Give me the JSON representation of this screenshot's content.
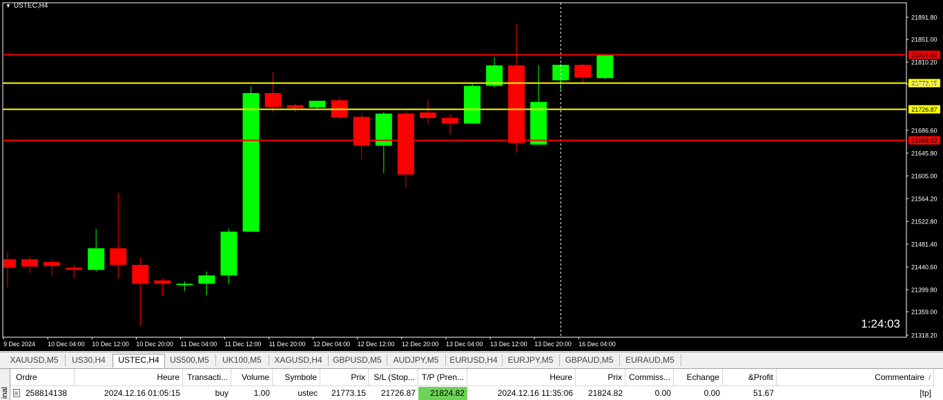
{
  "chart": {
    "title": "USTEC,H4",
    "countdown": "1:24:03",
    "price_labels": [
      "21891.80",
      "21851.00",
      "21810.20",
      "21769.40",
      "21686.60",
      "21645.80",
      "21605.00",
      "21564.20",
      "21522.80",
      "21481.40",
      "21440.60",
      "21399.80",
      "21359.00",
      "21318.20"
    ],
    "time_labels": [
      "9 Dec 2024",
      "10 Dec 04:00",
      "10 Dec 12:00",
      "10 Dec 20:00",
      "11 Dec 04:00",
      "11 Dec 12:00",
      "11 Dec 20:00",
      "12 Dec 04:00",
      "12 Dec 12:00",
      "12 Dec 20:00",
      "13 Dec 04:00",
      "13 Dec 12:00",
      "13 Dec 20:00",
      "16 Dec 04:00"
    ],
    "lines": [
      {
        "price": 21824.82,
        "label": "21824.82",
        "color": "#ff0000",
        "tag_color": "#ff0000",
        "text_color": "#000000"
      },
      {
        "price": 21773.15,
        "label": "21773.15",
        "color": "#ffff00",
        "tag_color": "#ffff00",
        "text_color": "#000000"
      },
      {
        "price": 21726.87,
        "label": "21726.87",
        "color": "#ffff00",
        "tag_color": "#ffff00",
        "text_color": "#000000"
      },
      {
        "price": 21669.82,
        "label": "21669.82",
        "color": "#ff0000",
        "tag_color": "#ff0000",
        "text_color": "#000000"
      }
    ],
    "candles": [
      {
        "o": 21455,
        "h": 21468,
        "l": 21405,
        "c": 21440
      },
      {
        "o": 21455,
        "h": 21460,
        "l": 21430,
        "c": 21442
      },
      {
        "o": 21450,
        "h": 21455,
        "l": 21425,
        "c": 21443
      },
      {
        "o": 21440,
        "h": 21445,
        "l": 21420,
        "c": 21436
      },
      {
        "o": 21436,
        "h": 21510,
        "l": 21433,
        "c": 21475
      },
      {
        "o": 21475,
        "h": 21575,
        "l": 21420,
        "c": 21445
      },
      {
        "o": 21445,
        "h": 21458,
        "l": 21335,
        "c": 21411
      },
      {
        "o": 21417,
        "h": 21420,
        "l": 21390,
        "c": 21411
      },
      {
        "o": 21409,
        "h": 21415,
        "l": 21398,
        "c": 21411
      },
      {
        "o": 21411,
        "h": 21433,
        "l": 21390,
        "c": 21426
      },
      {
        "o": 21426,
        "h": 21510,
        "l": 21410,
        "c": 21505
      },
      {
        "o": 21505,
        "h": 21767,
        "l": 21505,
        "c": 21755
      },
      {
        "o": 21755,
        "h": 21793,
        "l": 21720,
        "c": 21730
      },
      {
        "o": 21733,
        "h": 21736,
        "l": 21720,
        "c": 21728
      },
      {
        "o": 21729,
        "h": 21741,
        "l": 21727,
        "c": 21741
      },
      {
        "o": 21742,
        "h": 21747,
        "l": 21708,
        "c": 21711
      },
      {
        "o": 21712,
        "h": 21718,
        "l": 21635,
        "c": 21660
      },
      {
        "o": 21660,
        "h": 21721,
        "l": 21610,
        "c": 21718
      },
      {
        "o": 21718,
        "h": 21723,
        "l": 21585,
        "c": 21608
      },
      {
        "o": 21720,
        "h": 21743,
        "l": 21700,
        "c": 21710
      },
      {
        "o": 21710,
        "h": 21717,
        "l": 21680,
        "c": 21700
      },
      {
        "o": 21700,
        "h": 21772,
        "l": 21700,
        "c": 21768
      },
      {
        "o": 21768,
        "h": 21820,
        "l": 21765,
        "c": 21805
      },
      {
        "o": 21805,
        "h": 21880,
        "l": 21648,
        "c": 21665
      },
      {
        "o": 21662,
        "h": 21805,
        "l": 21662,
        "c": 21739
      },
      {
        "o": 21778,
        "h": 21808,
        "l": 21760,
        "c": 21806
      },
      {
        "o": 21806,
        "h": 21808,
        "l": 21772,
        "c": 21783
      },
      {
        "o": 21782,
        "h": 21825,
        "l": 21780,
        "c": 21825
      }
    ],
    "bull_color": "#00ff00",
    "bear_color": "#ff0000",
    "crosshair_index": 25
  },
  "tabs": [
    {
      "label": "XAUUSD,M5",
      "active": false
    },
    {
      "label": "US30,H4",
      "active": false
    },
    {
      "label": "USTEC,H4",
      "active": true
    },
    {
      "label": "US500,M5",
      "active": false
    },
    {
      "label": "UK100,M5",
      "active": false
    },
    {
      "label": "XAGUSD,H4",
      "active": false
    },
    {
      "label": "GBPUSD,M5",
      "active": false
    },
    {
      "label": "AUDJPY,M5",
      "active": false
    },
    {
      "label": "EURUSD,H4",
      "active": false
    },
    {
      "label": "EURJPY,M5",
      "active": false
    },
    {
      "label": "GBPAUD,M5",
      "active": false
    },
    {
      "label": "EURAUD,M5",
      "active": false
    }
  ],
  "terminal": {
    "side_label": "inal",
    "columns": [
      "Ordre",
      "Heure",
      "Transacti...",
      "Volume",
      "Symbole",
      "Prix",
      "S/L (Stop...",
      "T/P (Pren...",
      "Heure",
      "Prix",
      "Commiss...",
      "Echange",
      "&Profit",
      "Commentaire"
    ],
    "row": [
      "258814138",
      "2024.12.16 01:05:15",
      "buy",
      "1.00",
      "ustec",
      "21773.15",
      "21726.87",
      "21824.82",
      "2024.12.16 11:35:06",
      "21824.82",
      "0.00",
      "0.00",
      "51.67",
      "[tp]"
    ],
    "sort_arrow": "/"
  }
}
